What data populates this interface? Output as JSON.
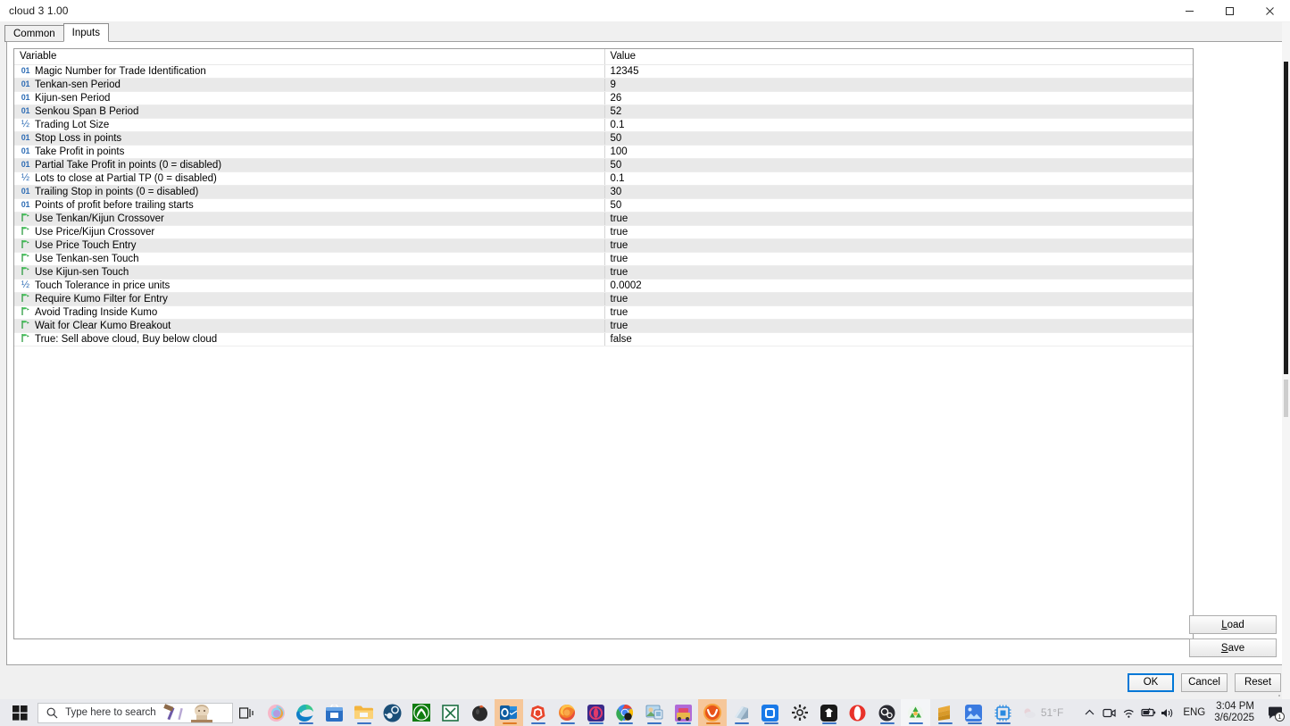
{
  "window": {
    "title": "cloud 3 1.00",
    "controls": {
      "minimize": "minimize-button",
      "maximize": "maximize-button",
      "close": "close-button"
    }
  },
  "tabs": [
    {
      "label": "Common",
      "active": false
    },
    {
      "label": "Inputs",
      "active": true
    }
  ],
  "grid": {
    "columns": [
      "Variable",
      "Value"
    ],
    "rows": [
      {
        "icon": "int",
        "variable": "Magic Number for Trade Identification",
        "value": "12345"
      },
      {
        "icon": "int",
        "variable": "Tenkan-sen Period",
        "value": "9"
      },
      {
        "icon": "int",
        "variable": "Kijun-sen Period",
        "value": "26"
      },
      {
        "icon": "int",
        "variable": "Senkou Span B Period",
        "value": "52"
      },
      {
        "icon": "dbl",
        "variable": "Trading Lot Size",
        "value": "0.1"
      },
      {
        "icon": "int",
        "variable": "Stop Loss in points",
        "value": "50"
      },
      {
        "icon": "int",
        "variable": "Take Profit in points",
        "value": "100"
      },
      {
        "icon": "int",
        "variable": "Partial Take Profit in points (0 = disabled)",
        "value": "50"
      },
      {
        "icon": "dbl",
        "variable": "Lots to close at Partial TP (0 = disabled)",
        "value": "0.1"
      },
      {
        "icon": "int",
        "variable": "Trailing Stop in points (0 = disabled)",
        "value": "30"
      },
      {
        "icon": "int",
        "variable": "Points of profit before trailing starts",
        "value": "50"
      },
      {
        "icon": "bool",
        "variable": "Use Tenkan/Kijun Crossover",
        "value": "true"
      },
      {
        "icon": "bool",
        "variable": "Use Price/Kijun Crossover",
        "value": "true"
      },
      {
        "icon": "bool",
        "variable": "Use Price Touch Entry",
        "value": "true"
      },
      {
        "icon": "bool",
        "variable": "Use Tenkan-sen Touch",
        "value": "true"
      },
      {
        "icon": "bool",
        "variable": "Use Kijun-sen Touch",
        "value": "true"
      },
      {
        "icon": "dbl",
        "variable": "Touch Tolerance in price units",
        "value": "0.0002"
      },
      {
        "icon": "bool",
        "variable": "Require Kumo Filter for Entry",
        "value": "true"
      },
      {
        "icon": "bool",
        "variable": "Avoid Trading Inside Kumo",
        "value": "true"
      },
      {
        "icon": "bool",
        "variable": "Wait for Clear Kumo Breakout",
        "value": "true"
      },
      {
        "icon": "bool",
        "variable": "True: Sell above cloud, Buy below cloud",
        "value": "false"
      }
    ]
  },
  "side_buttons": {
    "load": "Load",
    "load_mnemonic": "L",
    "load_rest": "oad",
    "save": "Save",
    "save_mnemonic": "S",
    "save_rest": "ave"
  },
  "dialog_buttons": {
    "ok": "OK",
    "cancel": "Cancel",
    "reset": "Reset"
  },
  "taskbar": {
    "search_placeholder": "Type here to search",
    "apps": [
      "task-view-icon",
      "copilot-icon",
      "edge-icon",
      "microsoft-store-icon",
      "file-explorer-icon",
      "steam-icon",
      "xbox-icon",
      "excel-icon",
      "unknown-dark-icon",
      "outlook-icon",
      "brave-icon",
      "firefox-icon",
      "opera-gx-icon",
      "chrome-icon",
      "photos-legacy-icon",
      "casino-game-icon",
      "vivaldi-icon",
      "notebook-icon",
      "obsidian-icon",
      "settings-icon",
      "spotify-dark-icon",
      "opera-icon",
      "obs-studio-icon",
      "recycle-icon",
      "sublime-icon",
      "photos-icon",
      "cpu-monitor-icon"
    ],
    "weather": "51°F",
    "language": "ENG",
    "time": "3:04 PM",
    "date": "3/6/2025",
    "notification_count": "1"
  },
  "colors": {
    "accent": "#0078d7",
    "int_icon": "#2f6db5",
    "bool_icon": "#2b9b3e",
    "row_alt": "#e9e9e9",
    "taskbar_active": "#f6c79a"
  }
}
